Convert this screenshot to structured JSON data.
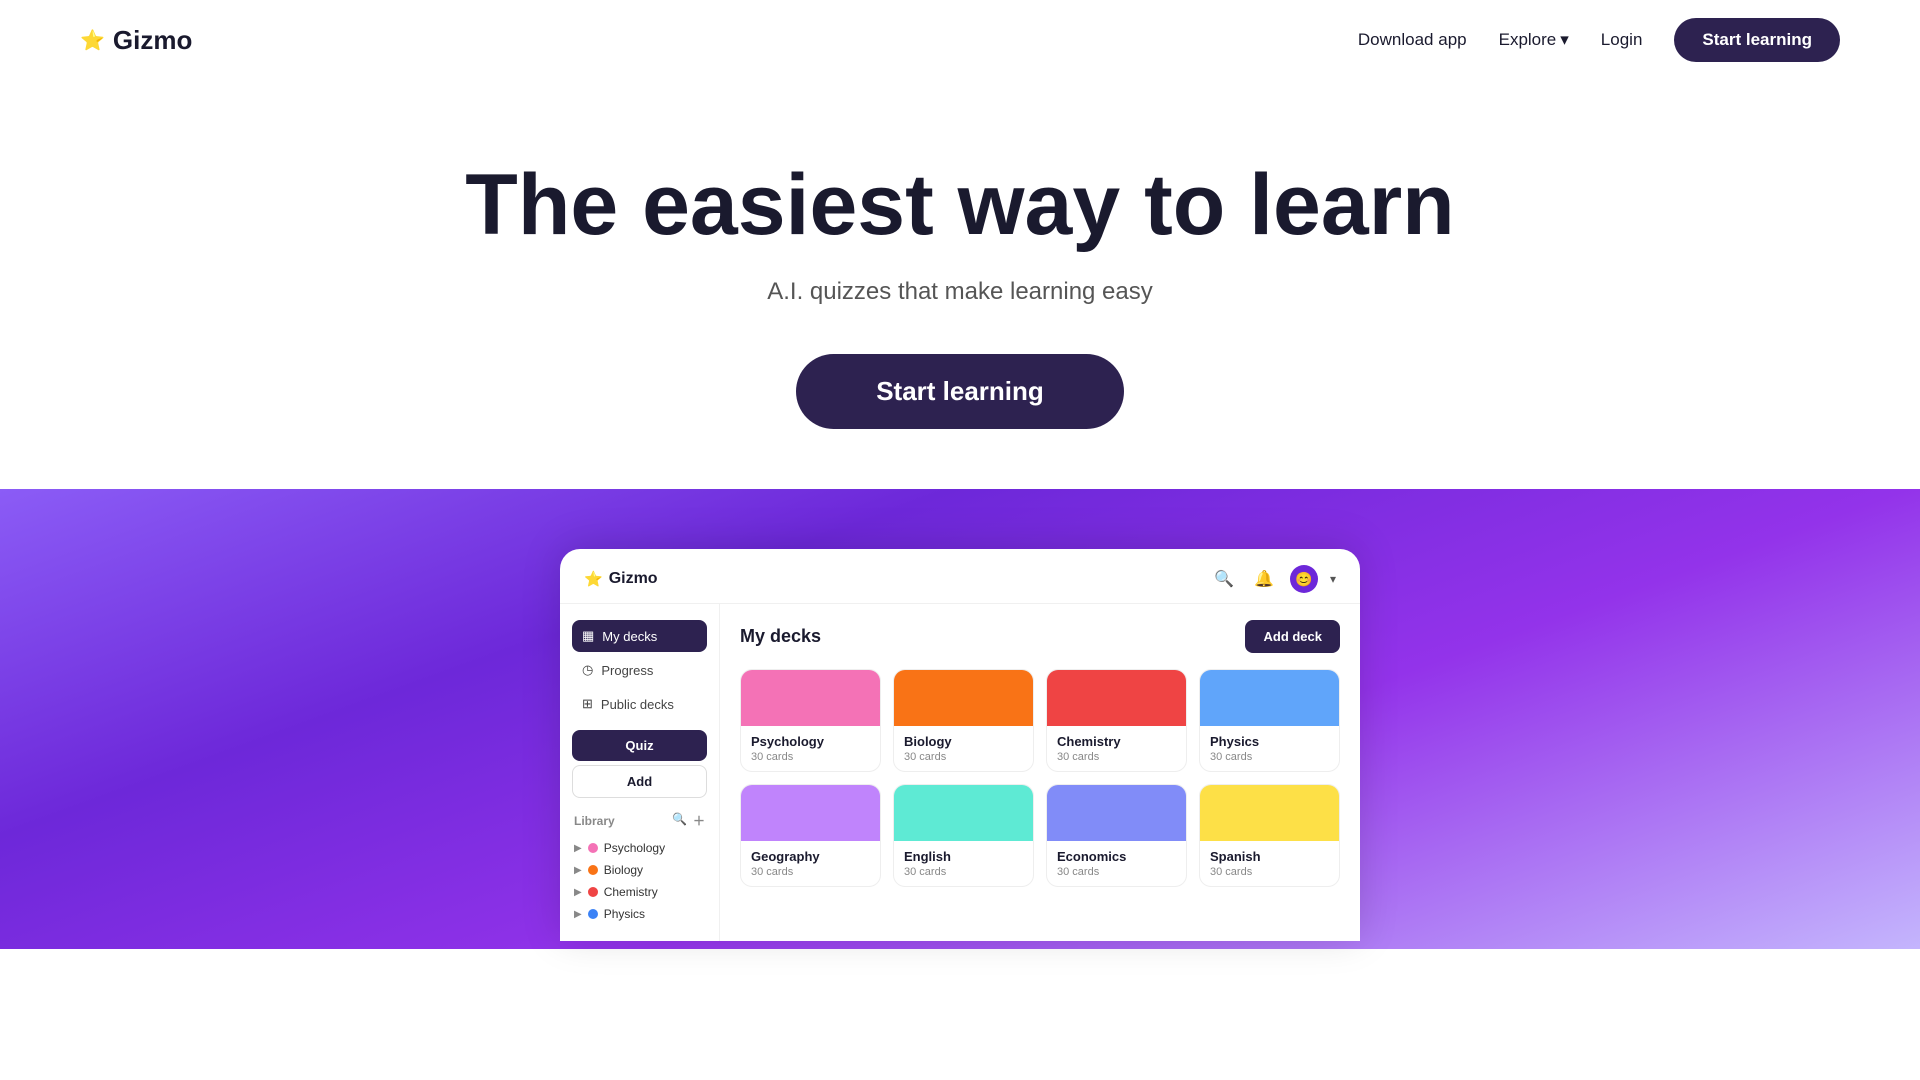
{
  "nav": {
    "logo_text": "Gizmo",
    "download_app": "Download app",
    "explore": "Explore",
    "login": "Login",
    "start_learning": "Start learning"
  },
  "hero": {
    "heading": "The easiest way to learn",
    "subheading": "A.I. quizzes that make learning easy",
    "cta": "Start learning"
  },
  "app": {
    "logo_text": "Gizmo",
    "sidebar": {
      "my_decks": "My decks",
      "progress": "Progress",
      "public_decks": "Public decks",
      "quiz_btn": "Quiz",
      "add_btn": "Add",
      "library_label": "Library",
      "library_items": [
        {
          "name": "Psychology",
          "color": "#f472b6"
        },
        {
          "name": "Biology",
          "color": "#f97316"
        },
        {
          "name": "Chemistry",
          "color": "#ef4444"
        },
        {
          "name": "Physics",
          "color": "#3b82f6"
        }
      ]
    },
    "main": {
      "title": "My decks",
      "add_deck_btn": "Add deck",
      "decks": [
        {
          "name": "Psychology",
          "cards": "30 cards",
          "color": "#f472b6"
        },
        {
          "name": "Biology",
          "cards": "30 cards",
          "color": "#f97316"
        },
        {
          "name": "Chemistry",
          "cards": "30 cards",
          "color": "#ef4444"
        },
        {
          "name": "Physics",
          "cards": "30 cards",
          "color": "#60a5fa"
        },
        {
          "name": "Geography",
          "cards": "30 cards",
          "color": "#c084fc"
        },
        {
          "name": "English",
          "cards": "30 cards",
          "color": "#5eead4"
        },
        {
          "name": "Economics",
          "cards": "30 cards",
          "color": "#818cf8"
        },
        {
          "name": "Spanish",
          "cards": "30 cards",
          "color": "#fde047"
        }
      ]
    }
  }
}
